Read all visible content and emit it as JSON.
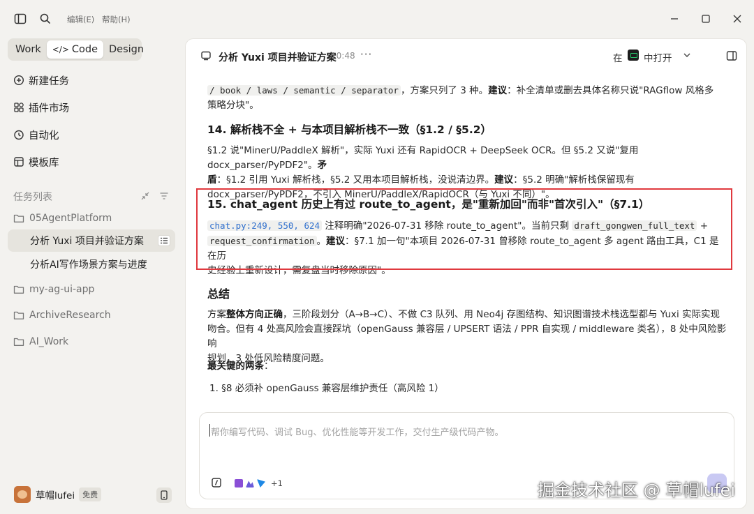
{
  "titlebar": {
    "menu_edit": "编辑(E)",
    "menu_help": "帮助(H)"
  },
  "sidebar": {
    "modes": [
      "Work",
      "Code",
      "Design"
    ],
    "active_mode": "Code",
    "nav": [
      {
        "label": "新建任务",
        "icon": "new-task-icon"
      },
      {
        "label": "插件市场",
        "icon": "plugin-icon"
      },
      {
        "label": "自动化",
        "icon": "clock-icon"
      },
      {
        "label": "模板库",
        "icon": "template-icon"
      }
    ],
    "tasks_title": "任务列表",
    "projects": [
      {
        "label": "05AgentPlatform",
        "tasks": [
          "分析 Yuxi 项目并验证方案",
          "分析AI写作场景方案与进度"
        ]
      },
      {
        "label": "my-ag-ui-app"
      },
      {
        "label": "ArchiveResearch"
      },
      {
        "label": "AI_Work"
      }
    ],
    "active_task": "分析 Yuxi 项目并验证方案",
    "user": {
      "name": "草帽lufei",
      "plan": "免费"
    }
  },
  "header": {
    "title": "分析 Yuxi 项目并验证方案",
    "time": "10:48",
    "more": "···",
    "in_label": "在",
    "open_label": "中打开"
  },
  "content": {
    "p1_code": "/ book / laws / semantic / separator",
    "p1_a": "，方案只列了 3 种。",
    "p1_label": "建议",
    "p1_b": "：补全清单或删去具体名称只说\"RAGflow 风格多",
    "p1_c": "策略分块\"。",
    "h14": "14. 解析栈不全 + 与本项目解析栈不一致（§1.2 / §5.2）",
    "p14_l1a": "§1.2 说\"MinerU/PaddleX 解析\"，实际 Yuxi 还有 RapidOCR + DeepSeek OCR。但 §5.2 又说\"复用 docx_parser/PyPDF2\"。",
    "p14_l1b": "矛",
    "p14_l2a": "盾",
    "p14_l2b": "：§1.2 引用 Yuxi 解析栈，§5.2 又用本项目解析栈，没说清边界。",
    "p14_l2c": "建议",
    "p14_l2d": "：§5.2 明确\"解析栈保留现有",
    "p14_l3": "docx_parser/PyPDF2，不引入 MinerU/PaddleX/RapidOCR（与 Yuxi 不同）\"。",
    "h15": "15. chat_agent 历史上有过 route_to_agent，是\"重新加回\"而非\"首次引入\"（§7.1）",
    "p15_code1": "chat.py:249, 550, 624",
    "p15_a": " 注释明确\"2026-07-31 移除 route_to_agent\"。当前只剩 ",
    "p15_code2": "draft_gongwen_full_text",
    "p15_b": " +",
    "p15_code3": "request_confirmation",
    "p15_c": "。",
    "p15_label": "建议",
    "p15_d": "：§7.1 加一句\"本项目 2026-07-31 曾移除 route_to_agent 多 agent 路由工具，C1 是在历",
    "p15_e": "史经验上重新设计，需复盘当时移除原因\"。",
    "summary_title": "总结",
    "s1_a": "方案",
    "s1_b": "整体方向正确",
    "s1_c": "，三阶段划分（A→B→C）、不做 C3 队列、用 Neo4j 存图结构、知识图谱技术栈选型都与 Yuxi 实际实现",
    "s1_d": "吻合。但有 4 处高风险会直接踩坑（openGauss 兼容层 / UPSERT 语法 / PPR 自实现 / middleware 类名），8 处中风险影响",
    "s1_e": "规划，3 处低风险精度问题。",
    "key_title": "最关键的两条",
    "key_colon": "：",
    "key_item1": "1. §8 必须补 openGauss 兼容层维护责任（高风险 1）"
  },
  "composer": {
    "placeholder": "帮你编写代码、调试 Bug、优化性能等开发工作，交付生产级代码产物。",
    "plus_count": "+1"
  },
  "watermark": "掘金技术社区 @ 草帽lufei",
  "colors": {
    "accent_red": "#e0393e",
    "link_blue": "#2f6fcd",
    "send_button": "#c9c9f3"
  }
}
